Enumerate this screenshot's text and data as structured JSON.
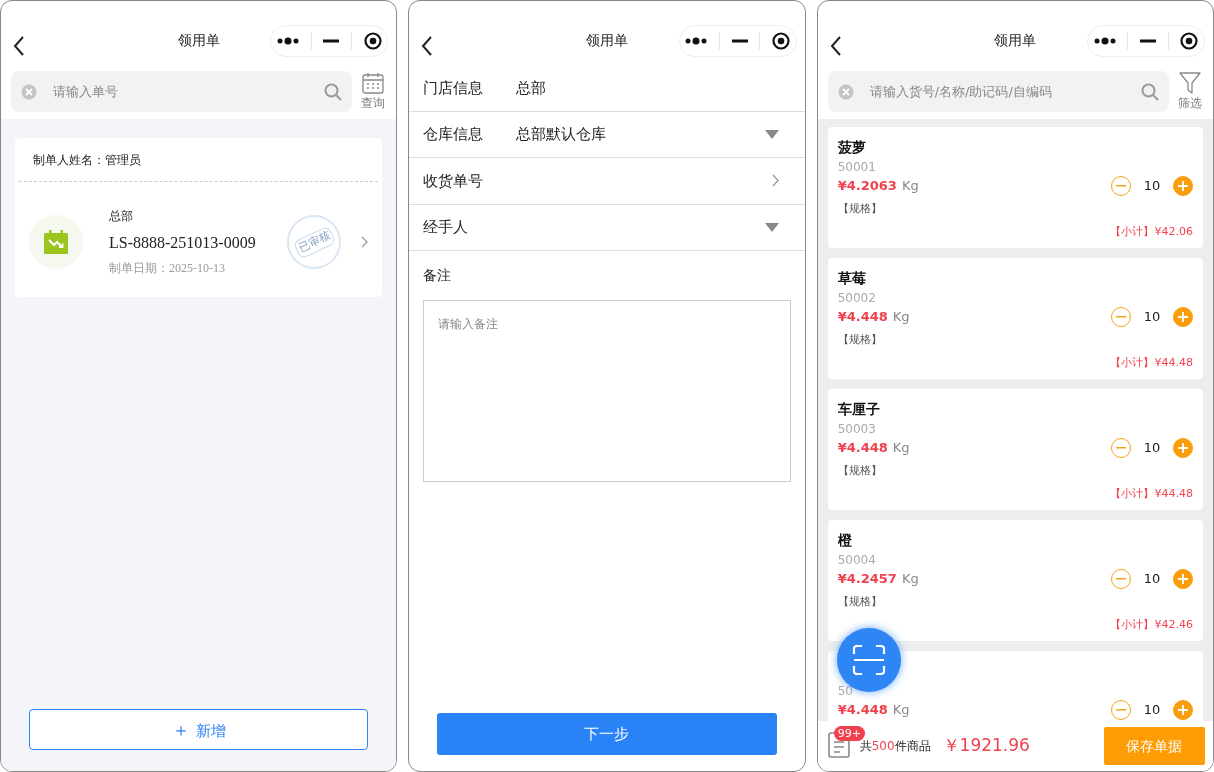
{
  "screens": [
    {
      "title": "领用单",
      "search": {
        "placeholder": "请输入单号"
      },
      "side_action": {
        "kind": "calendar",
        "label": "查询"
      },
      "orders": [
        {
          "maker": "制单人姓名：管理员",
          "store": "总部",
          "number": "LS-8888-251013-0009",
          "date": "制单日期：2025-10-13",
          "stamp": "已审核"
        }
      ],
      "add_button": {
        "icon": "＋",
        "label": "新增"
      }
    },
    {
      "title": "领用单",
      "fields": [
        {
          "label": "门店信息",
          "value": "总部",
          "kind": "plain"
        },
        {
          "label": "仓库信息",
          "value": "总部默认仓库",
          "kind": "dropdown"
        },
        {
          "label": "收货单号",
          "kind": "link"
        },
        {
          "label": "经手人",
          "kind": "dropdown"
        }
      ],
      "remark": {
        "label": "备注",
        "placeholder": "请输入备注"
      },
      "next_button": "下一步"
    },
    {
      "title": "领用单",
      "search": {
        "placeholder": "请输入货号/名称/助记码/自编码"
      },
      "side_action": {
        "kind": "filter",
        "label": "筛选"
      },
      "products": [
        {
          "name": "菠萝",
          "code": "50001",
          "price": "¥4.2063",
          "unit": "Kg",
          "qty": "10",
          "spec": "【规格】",
          "subtotal": "【小计】¥42.06"
        },
        {
          "name": "草莓",
          "code": "50002",
          "price": "¥4.448",
          "unit": "Kg",
          "qty": "10",
          "spec": "【规格】",
          "subtotal": "【小计】¥44.48"
        },
        {
          "name": "车厘子",
          "code": "50003",
          "price": "¥4.448",
          "unit": "Kg",
          "qty": "10",
          "spec": "【规格】",
          "subtotal": "【小计】¥44.48"
        },
        {
          "name": "橙",
          "code": "50004",
          "price": "¥4.2457",
          "unit": "Kg",
          "qty": "10",
          "spec": "【规格】",
          "subtotal": "【小计】¥42.46"
        },
        {
          "code": "50",
          "price": "¥4.448",
          "unit": "Kg",
          "qty": "10"
        }
      ],
      "cart": {
        "badge": "99+",
        "prefix": "共",
        "count": "500",
        "suffix": "件商品",
        "total": "￥1921.96",
        "save_button": "保存单据"
      }
    }
  ]
}
